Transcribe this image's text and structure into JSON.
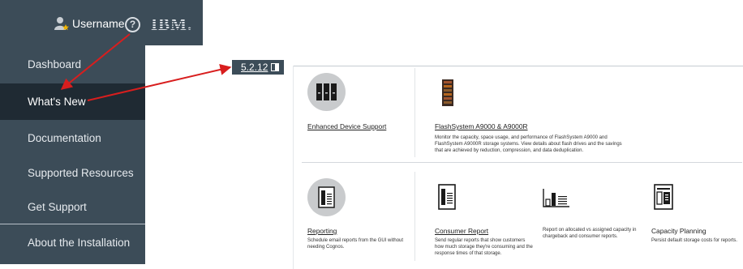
{
  "header": {
    "username": "Username",
    "help_icon": "question-mark-icon",
    "logo": "IBM."
  },
  "menu": {
    "items": [
      {
        "label": "Dashboard",
        "active": false
      },
      {
        "label": "What's New",
        "active": true
      },
      {
        "label": "Documentation",
        "active": false
      },
      {
        "label": "Supported Resources",
        "active": false
      },
      {
        "label": "Get Support",
        "active": false
      },
      {
        "label": "About the Installation",
        "active": false
      }
    ]
  },
  "version_tab": {
    "label": "5.2.12"
  },
  "cards": {
    "enhanced": {
      "title": "Enhanced Device Support"
    },
    "flashsystem": {
      "title": "FlashSystem A9000 & A9000R",
      "desc": "Monitor the capacity, space usage, and performance of FlashSystem A9000 and FlashSystem A9000R storage systems. View details about flash drives and the savings that are achieved by reduction, compression, and data deduplication."
    },
    "reporting": {
      "title": "Reporting",
      "desc": "Schedule email reports from the GUI without needing Cognos."
    },
    "consumer": {
      "title": "Consumer Report",
      "desc": "Send regular reports that show customers how much storage they're consuming and the response times of that storage."
    },
    "chargeback": {
      "desc": "Report on allocated vs assigned capacity in chargeback and consumer reports."
    },
    "capacity": {
      "title": "Capacity Planning",
      "desc": "Persist default storage costs for reports."
    }
  },
  "colors": {
    "nav_bg": "#3c4c58",
    "nav_active": "#1f2a33",
    "annotation_arrow": "#d81e1e"
  }
}
